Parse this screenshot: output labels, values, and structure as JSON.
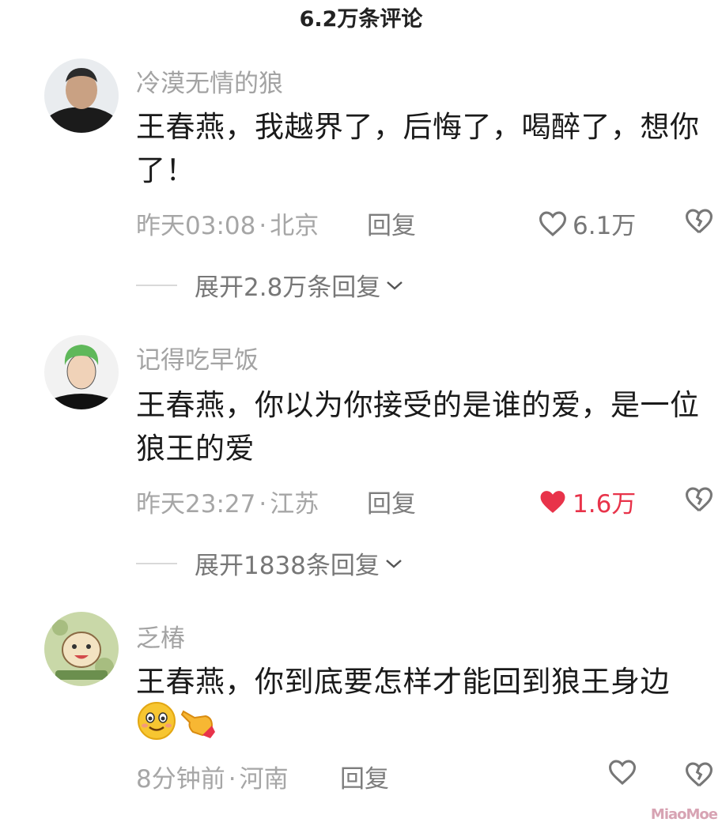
{
  "header": {
    "title": "6.2万条评论"
  },
  "comments": [
    {
      "username": "冷漠无情的狼",
      "text": "王春燕，我越界了，后悔了，喝醉了，想你了！",
      "time": "昨天03:08",
      "location": "北京",
      "reply_label": "回复",
      "likes": "6.1万",
      "liked": false,
      "expand_label": "展开2.8万条回复"
    },
    {
      "username": "记得吃早饭",
      "text": "王春燕，你以为你接受的是谁的爱，是一位狼王的爱",
      "time": "昨天23:27",
      "location": "江苏",
      "reply_label": "回复",
      "likes": "1.6万",
      "liked": true,
      "expand_label": "展开1838条回复"
    },
    {
      "username": "乏椿",
      "text": "王春燕，你到底要怎样才能回到狼王身边",
      "time": "8分钟前",
      "location": "河南",
      "reply_label": "回复",
      "likes": "",
      "liked": false,
      "emojis": [
        "smiling-face-icon",
        "pointing-hand-icon"
      ]
    }
  ],
  "watermark": "MiaoMoe",
  "colors": {
    "liked": "#e8334a",
    "muted": "#a6a6a6",
    "text": "#1a1a1a"
  }
}
